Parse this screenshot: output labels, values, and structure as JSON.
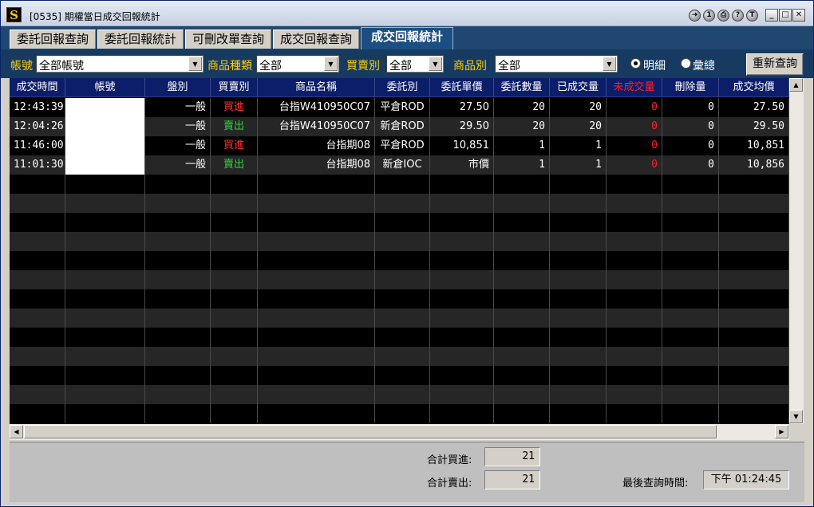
{
  "window": {
    "title": "[0535] 期權當日成交回報統計",
    "app_icon": "S",
    "toolbar_icons": [
      "arrow-icon",
      "info-icon",
      "print-icon",
      "help-icon",
      "t-icon"
    ],
    "controls": {
      "minimize": "_",
      "maximize": "□",
      "close": "✕"
    }
  },
  "tabs": [
    {
      "label": "委託回報查詢",
      "active": false
    },
    {
      "label": "委託回報統計",
      "active": false
    },
    {
      "label": "可刪改單查詢",
      "active": false
    },
    {
      "label": "成交回報查詢",
      "active": false
    },
    {
      "label": "成交回報統計",
      "active": true
    }
  ],
  "filters": {
    "account_label": "帳號",
    "account_value": "全部帳號",
    "product_type_label": "商品種類",
    "product_type_value": "全部",
    "side_label": "買賣別",
    "side_value": "全部",
    "product_label": "商品別",
    "product_value": "全部",
    "detail_label": "明細",
    "summary_label": "彙總",
    "selected_mode": "detail",
    "requery_label": "重新查詢"
  },
  "grid": {
    "columns": [
      "成交時間",
      "帳號",
      "盤別",
      "買賣別",
      "商品名稱",
      "委託別",
      "委託單價",
      "委託數量",
      "已成交量",
      "未成交量",
      "刪除量",
      "成交均價"
    ],
    "rows": [
      {
        "time": "12:43:39",
        "account": "",
        "session": "一般",
        "side": "買進",
        "side_type": "buy",
        "product": "台指W410950C07",
        "order_type": "平倉ROD",
        "price": "27.50",
        "qty": "20",
        "filled": "20",
        "unfilled": "0",
        "deleted": "0",
        "avg": "27.50"
      },
      {
        "time": "12:04:26",
        "account": "",
        "session": "一般",
        "side": "賣出",
        "side_type": "sell",
        "product": "台指W410950C07",
        "order_type": "新倉ROD",
        "price": "29.50",
        "qty": "20",
        "filled": "20",
        "unfilled": "0",
        "deleted": "0",
        "avg": "29.50"
      },
      {
        "time": "11:46:00",
        "account": "",
        "session": "一般",
        "side": "買進",
        "side_type": "buy",
        "product": "台指期08",
        "order_type": "平倉ROD",
        "price": "10,851",
        "qty": "1",
        "filled": "1",
        "unfilled": "0",
        "deleted": "0",
        "avg": "10,851"
      },
      {
        "time": "11:01:30",
        "account": "",
        "session": "一般",
        "side": "賣出",
        "side_type": "sell",
        "product": "台指期08",
        "order_type": "新倉IOC",
        "price": "市價",
        "qty": "1",
        "filled": "1",
        "unfilled": "0",
        "deleted": "0",
        "avg": "10,856"
      }
    ]
  },
  "summary": {
    "total_buy_label": "合計買進:",
    "total_buy_value": "21",
    "total_sell_label": "合計賣出:",
    "total_sell_value": "21",
    "last_query_label": "最後查詢時間:",
    "last_query_value": "下午 01:24:45"
  },
  "colors": {
    "header_bg": "#0c1e6a",
    "tab_active_bg": "#1b4f82",
    "filter_bg": "#163a60",
    "label_yellow": "#ffcc00",
    "buy_red": "#ff3030",
    "sell_green": "#30d040"
  }
}
